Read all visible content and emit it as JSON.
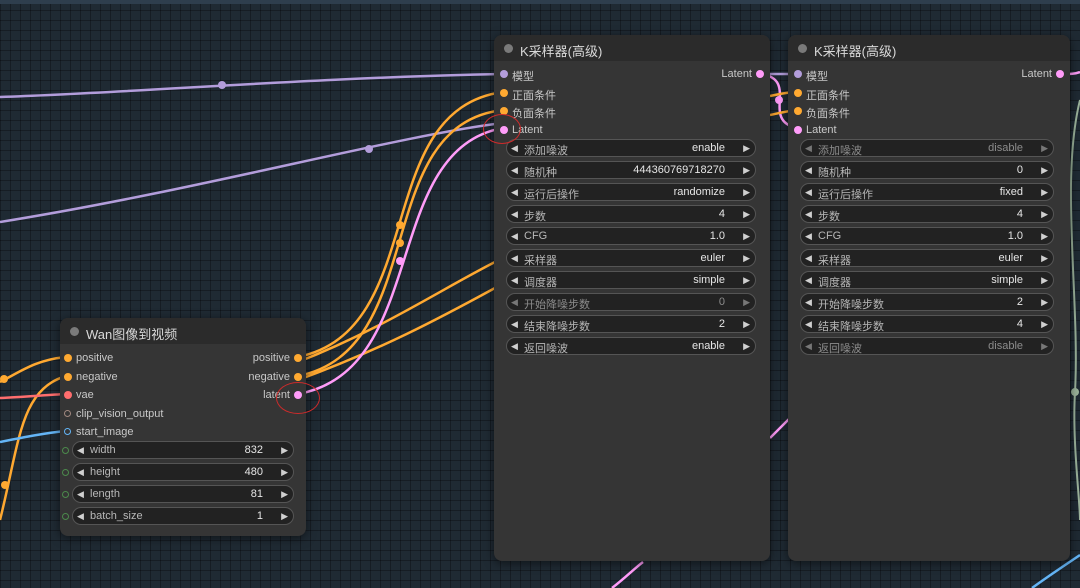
{
  "canvas": {
    "background": "#1f2a33"
  },
  "link_colors": {
    "model": "#b39ddb",
    "conditioning": "#ffa931",
    "latent": "#ff9cf9",
    "vae": "#ff6e6e",
    "image": "#64b5f6",
    "clip_vision": "#a1887f"
  },
  "wan_node": {
    "title": "Wan图像到视频",
    "inputs": [
      {
        "label": "positive",
        "color": "#ffa931"
      },
      {
        "label": "negative",
        "color": "#ffa931"
      },
      {
        "label": "vae",
        "color": "#ff6e6e"
      },
      {
        "label": "clip_vision_output",
        "color": "#a1887f"
      },
      {
        "label": "start_image",
        "color": "#64b5f6"
      }
    ],
    "outputs": [
      {
        "label": "positive",
        "color": "#ffa931"
      },
      {
        "label": "negative",
        "color": "#ffa931"
      },
      {
        "label": "latent",
        "color": "#ff9cf9"
      }
    ],
    "widgets": [
      {
        "label": "width",
        "value": "832"
      },
      {
        "label": "height",
        "value": "480"
      },
      {
        "label": "length",
        "value": "81"
      },
      {
        "label": "batch_size",
        "value": "1"
      }
    ]
  },
  "ksampler_1": {
    "title": "K采样器(高级)",
    "inputs": [
      {
        "label": "模型",
        "color": "#b39ddb"
      },
      {
        "label": "正面条件",
        "color": "#ffa931"
      },
      {
        "label": "负面条件",
        "color": "#ffa931"
      },
      {
        "label": "Latent",
        "color": "#ff9cf9"
      }
    ],
    "output": {
      "label": "Latent",
      "color": "#ff9cf9"
    },
    "widgets": [
      {
        "label": "添加噪波",
        "value": "enable"
      },
      {
        "label": "随机种",
        "value": "444360769718270"
      },
      {
        "label": "运行后操作",
        "value": "randomize"
      },
      {
        "label": "步数",
        "value": "4"
      },
      {
        "label": "CFG",
        "value": "1.0"
      },
      {
        "label": "采样器",
        "value": "euler"
      },
      {
        "label": "调度器",
        "value": "simple"
      },
      {
        "label": "开始降噪步数",
        "value": "0"
      },
      {
        "label": "结束降噪步数",
        "value": "2"
      },
      {
        "label": "返回噪波",
        "value": "enable"
      }
    ]
  },
  "ksampler_2": {
    "title": "K采样器(高级)",
    "inputs": [
      {
        "label": "模型",
        "color": "#b39ddb"
      },
      {
        "label": "正面条件",
        "color": "#ffa931"
      },
      {
        "label": "负面条件",
        "color": "#ffa931"
      },
      {
        "label": "Latent",
        "color": "#ff9cf9"
      }
    ],
    "output": {
      "label": "Latent",
      "color": "#ff9cf9"
    },
    "widgets": [
      {
        "label": "添加噪波",
        "value": "disable"
      },
      {
        "label": "随机种",
        "value": "0"
      },
      {
        "label": "运行后操作",
        "value": "fixed"
      },
      {
        "label": "步数",
        "value": "4"
      },
      {
        "label": "CFG",
        "value": "1.0"
      },
      {
        "label": "采样器",
        "value": "euler"
      },
      {
        "label": "调度器",
        "value": "simple"
      },
      {
        "label": "开始降噪步数",
        "value": "2"
      },
      {
        "label": "结束降噪步数",
        "value": "4"
      },
      {
        "label": "返回噪波",
        "value": "disable"
      }
    ]
  }
}
